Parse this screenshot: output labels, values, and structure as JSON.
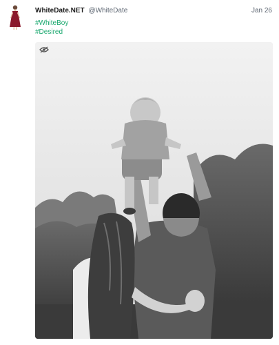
{
  "post": {
    "display_name": "WhiteDate.NET",
    "handle": "@WhiteDate",
    "date": "Jan 26",
    "hashtags": [
      "#WhiteBoy",
      "#Desired"
    ]
  },
  "icons": {
    "avatar": "woman-in-red-dress-avatar",
    "media_toggle": "eye-slash-icon"
  },
  "colors": {
    "hashtag": "#19a86e",
    "avatar_dress": "#8b1a2b"
  }
}
